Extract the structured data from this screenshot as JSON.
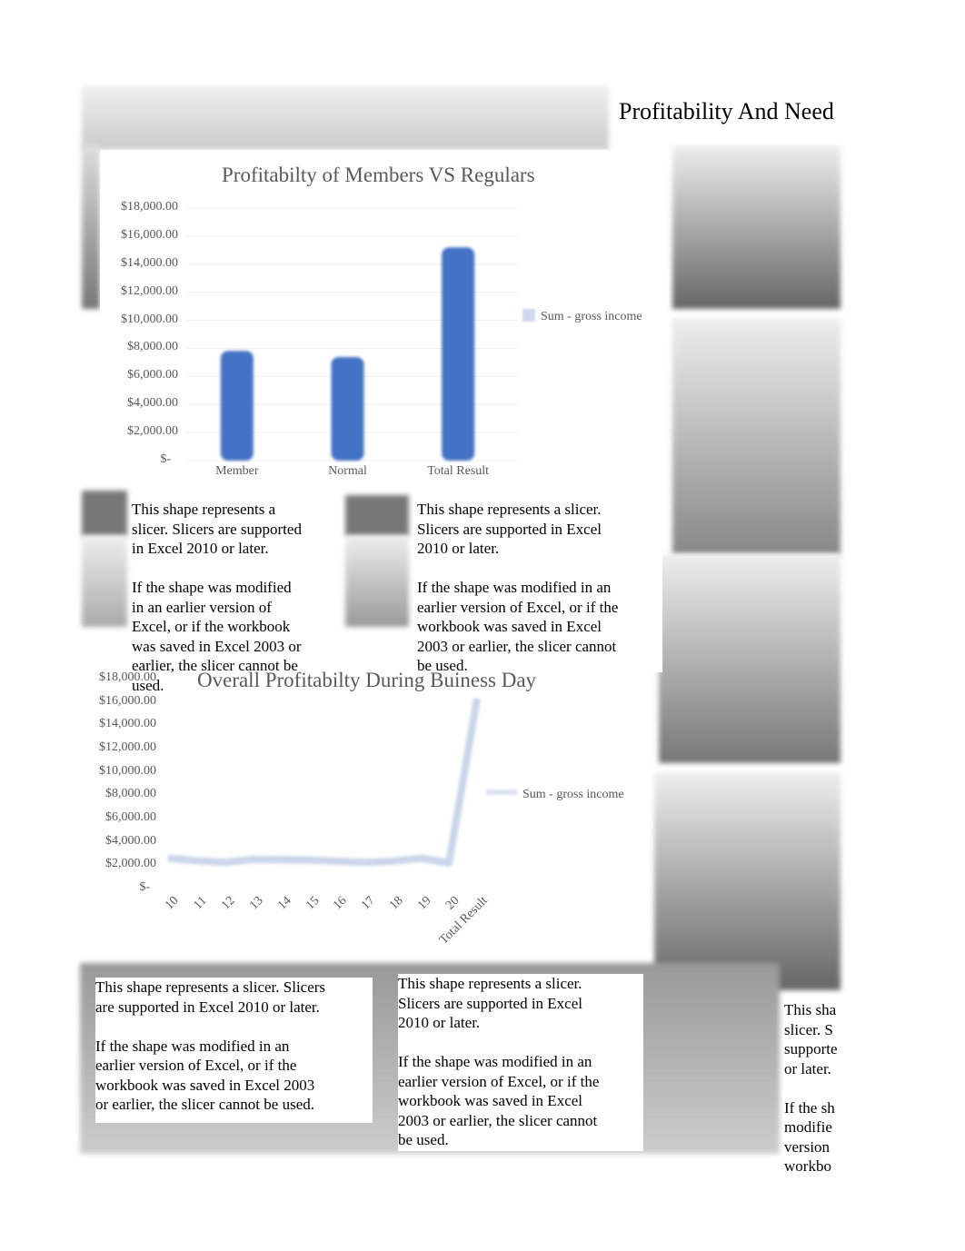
{
  "header": {
    "title": "Profitability And Need"
  },
  "slicer_text": {
    "a": "This shape represents a\nslicer. Slicers are supported\nin Excel 2010 or later.\n\nIf the shape was modified\nin an earlier version of\nExcel, or if the workbook\nwas saved in Excel 2003 or\nearlier, the slicer cannot be\nused.",
    "b": "This shape represents a slicer.\nSlicers are supported in Excel\n2010 or later.\n\nIf the shape was modified in an\nearlier version of Excel, or if the\nworkbook was saved in Excel\n2003 or earlier, the slicer cannot\nbe used.",
    "c": "This shape represents a slicer. Slicers\nare supported in Excel 2010 or later.\n\nIf the shape was modified in an\nearlier version of Excel, or if the\nworkbook was saved in Excel 2003\nor earlier, the slicer cannot be used.",
    "d": "This shape represents a slicer.\nSlicers are supported in Excel\n2010 or later.\n\nIf the shape was modified in an\nearlier version of Excel, or if the\nworkbook was saved in Excel\n2003 or earlier, the slicer cannot\nbe used.",
    "e": "This sha\nslicer. S\nsupporte\nor later.\n\nIf the sh\nmodifie\nversion \nworkbo"
  },
  "colors": {
    "bar": "#4472c4",
    "line": "#c9d5ea",
    "text": "#595959"
  },
  "chart_data": [
    {
      "type": "bar",
      "title": "Profitabilty of Members VS Regulars",
      "categories": [
        "Member",
        "Normal",
        "Total Result"
      ],
      "series": [
        {
          "name": "Sum - gross income",
          "values": [
            7820,
            7380,
            15200
          ]
        }
      ],
      "ylim": [
        0,
        18000
      ],
      "yticks": [
        "$-",
        "$2,000.00",
        "$4,000.00",
        "$6,000.00",
        "$8,000.00",
        "$10,000.00",
        "$12,000.00",
        "$14,000.00",
        "$16,000.00",
        "$18,000.00"
      ],
      "legend": "right",
      "grid": true
    },
    {
      "type": "line",
      "title": "Overall Profitabilty During Buiness Day",
      "categories": [
        "10",
        "11",
        "12",
        "13",
        "14",
        "15",
        "16",
        "17",
        "18",
        "19",
        "20",
        "Total Result"
      ],
      "series": [
        {
          "name": "Sum - gross income",
          "values": [
            1500,
            1300,
            1150,
            1400,
            1380,
            1350,
            1250,
            1150,
            1250,
            1500,
            1100,
            15200
          ]
        }
      ],
      "ylim": [
        0,
        18000
      ],
      "yticks": [
        "$-",
        "$2,000.00",
        "$4,000.00",
        "$6,000.00",
        "$8,000.00",
        "$10,000.00",
        "$12,000.00",
        "$14,000.00",
        "$16,000.00",
        "$18,000.00"
      ],
      "legend": "right",
      "grid": false
    }
  ]
}
